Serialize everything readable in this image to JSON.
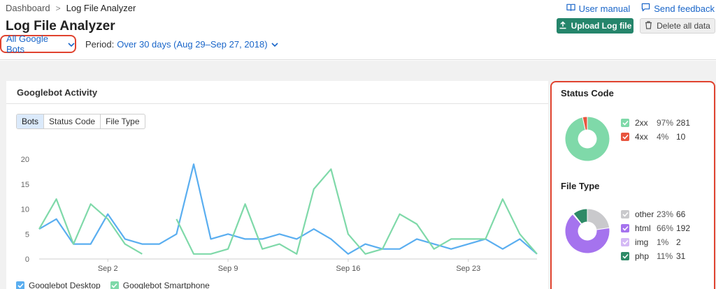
{
  "breadcrumb": {
    "home": "Dashboard",
    "separator": ">",
    "current": "Log File Analyzer"
  },
  "page": {
    "title": "Log File Analyzer"
  },
  "links": {
    "manual": "User manual",
    "feedback": "Send feedback"
  },
  "buttons": {
    "upload": "Upload Log file",
    "delete": "Delete all data"
  },
  "filters": {
    "bots": "All Google Bots",
    "period_label": "Period:",
    "period_value": "Over 30 days (Aug 29–Sep 27, 2018)"
  },
  "activity": {
    "title": "Googlebot Activity",
    "tabs": [
      "Bots",
      "Status Code",
      "File Type"
    ],
    "active_tab": 0
  },
  "chart_data": {
    "type": "line",
    "x": [
      "Aug 29",
      "Aug 30",
      "Aug 31",
      "Sep 1",
      "Sep 2",
      "Sep 3",
      "Sep 4",
      "Sep 5",
      "Sep 6",
      "Sep 7",
      "Sep 8",
      "Sep 9",
      "Sep 10",
      "Sep 11",
      "Sep 12",
      "Sep 13",
      "Sep 14",
      "Sep 15",
      "Sep 16",
      "Sep 17",
      "Sep 18",
      "Sep 19",
      "Sep 20",
      "Sep 21",
      "Sep 22",
      "Sep 23",
      "Sep 24",
      "Sep 25",
      "Sep 26",
      "Sep 27"
    ],
    "xticks": [
      "Sep 2",
      "Sep 9",
      "Sep 16",
      "Sep 23"
    ],
    "yticks": [
      0,
      5,
      10,
      15,
      20
    ],
    "ylim": [
      0,
      20
    ],
    "series": [
      {
        "name": "Googlebot Desktop",
        "color": "#5aaef0",
        "values": [
          6,
          8,
          3,
          3,
          9,
          4,
          3,
          3,
          5,
          19,
          4,
          5,
          4,
          4,
          5,
          4,
          6,
          4,
          1,
          3,
          2,
          2,
          4,
          3,
          2,
          3,
          4,
          2,
          4,
          1
        ]
      },
      {
        "name": "Googlebot Smartphone",
        "color": "#7fd9a9",
        "values": [
          6,
          12,
          3,
          11,
          8,
          3,
          1,
          null,
          8,
          1,
          1,
          2,
          11,
          2,
          3,
          1,
          14,
          18,
          5,
          1,
          2,
          9,
          7,
          2,
          4,
          4,
          4,
          12,
          5,
          1
        ]
      }
    ],
    "grid": false
  },
  "status_code": {
    "title": "Status Code",
    "items": [
      {
        "label": "2xx",
        "pct": "97%",
        "count": "281",
        "value": 281,
        "color": "#7fd9a9"
      },
      {
        "label": "4xx",
        "pct": "4%",
        "count": "10",
        "value": 10,
        "color": "#e8553f"
      }
    ]
  },
  "file_type": {
    "title": "File Type",
    "items": [
      {
        "label": "other",
        "pct": "23%",
        "count": "66",
        "value": 66,
        "color": "#c9c9cc"
      },
      {
        "label": "html",
        "pct": "66%",
        "count": "192",
        "value": 192,
        "color": "#a573ee"
      },
      {
        "label": "img",
        "pct": "1%",
        "count": "2",
        "value": 2,
        "color": "#d4b9f5"
      },
      {
        "label": "php",
        "pct": "11%",
        "count": "31",
        "value": 31,
        "color": "#2e8a67"
      }
    ]
  }
}
